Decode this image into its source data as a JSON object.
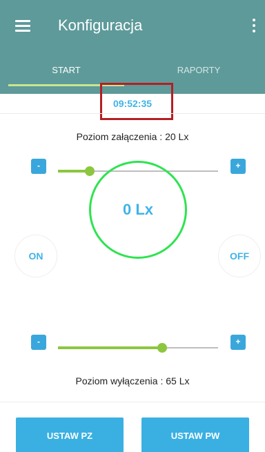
{
  "appbar": {
    "title": "Konfiguracja",
    "background_color": "#5e9a9a",
    "menu_icon": "hamburger-menu-icon",
    "overflow_icon": "vertical-ellipsis-icon"
  },
  "tabs": [
    {
      "label": "START",
      "selected": true
    },
    {
      "label": "RAPORTY",
      "selected": false
    }
  ],
  "clock": {
    "time": "09:52:35"
  },
  "on_level": {
    "label": "Poziom załączenia : 20 Lx",
    "value_percent": 20,
    "minus_label": "-",
    "plus_label": "+"
  },
  "off_level": {
    "label": "Poziom wyłączenia : 65 Lx",
    "value_percent": 65,
    "minus_label": "-",
    "plus_label": "+"
  },
  "meter": {
    "on_label": "ON",
    "off_label": "OFF",
    "reading": "0 Lx",
    "ring_color": "#2ee350"
  },
  "buttons": {
    "set_pz": "USTAW PZ",
    "set_pw": "USTAW PW"
  },
  "colors": {
    "accent": "#3fb3e6",
    "slider": "#8cc63f",
    "highlight_box": "#b41e23"
  }
}
